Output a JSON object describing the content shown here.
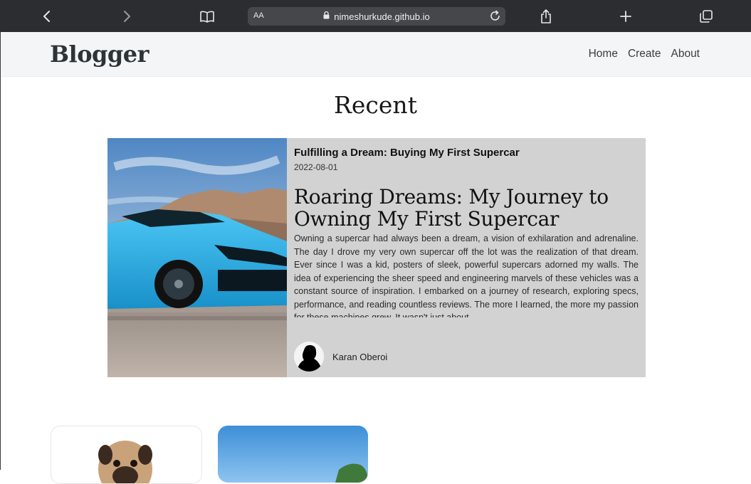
{
  "browser": {
    "address_prefix": "AA",
    "url": "nimeshurkude.github.io",
    "icons": [
      "chevron-left-icon",
      "chevron-right-icon",
      "book-icon",
      "lock-icon",
      "reload-icon",
      "share-icon",
      "plus-icon",
      "tabs-icon"
    ]
  },
  "site": {
    "brand": "Blogger",
    "nav": [
      "Home",
      "Create",
      "About"
    ]
  },
  "main": {
    "section_title": "Recent",
    "featured": {
      "title": "Fulfilling a Dream: Buying My First Supercar",
      "date": "2022-08-01",
      "heading": "Roaring Dreams: My Journey to Owning My First Supercar",
      "excerpt": "Owning a supercar had always been a dream, a vision of exhilaration and adrenaline. The day I drove my very own supercar off the lot was the realization of that dream. Ever since I was a kid, posters of sleek, powerful supercars adorned my walls. The idea of experiencing the sheer speed and engineering marvels of these vehicles was a constant source of inspiration. I embarked on a journey of research, exploring specs, performance, and reading countless reviews. The more I learned, the more my passion for these machines grew. It wasn't just about",
      "author": "Karan Oberoi"
    }
  },
  "colors": {
    "toolbar": "#2b2d30",
    "navbar": "#f4f5f7",
    "card": "#d2d2d2",
    "car": "#1fa7e0"
  }
}
